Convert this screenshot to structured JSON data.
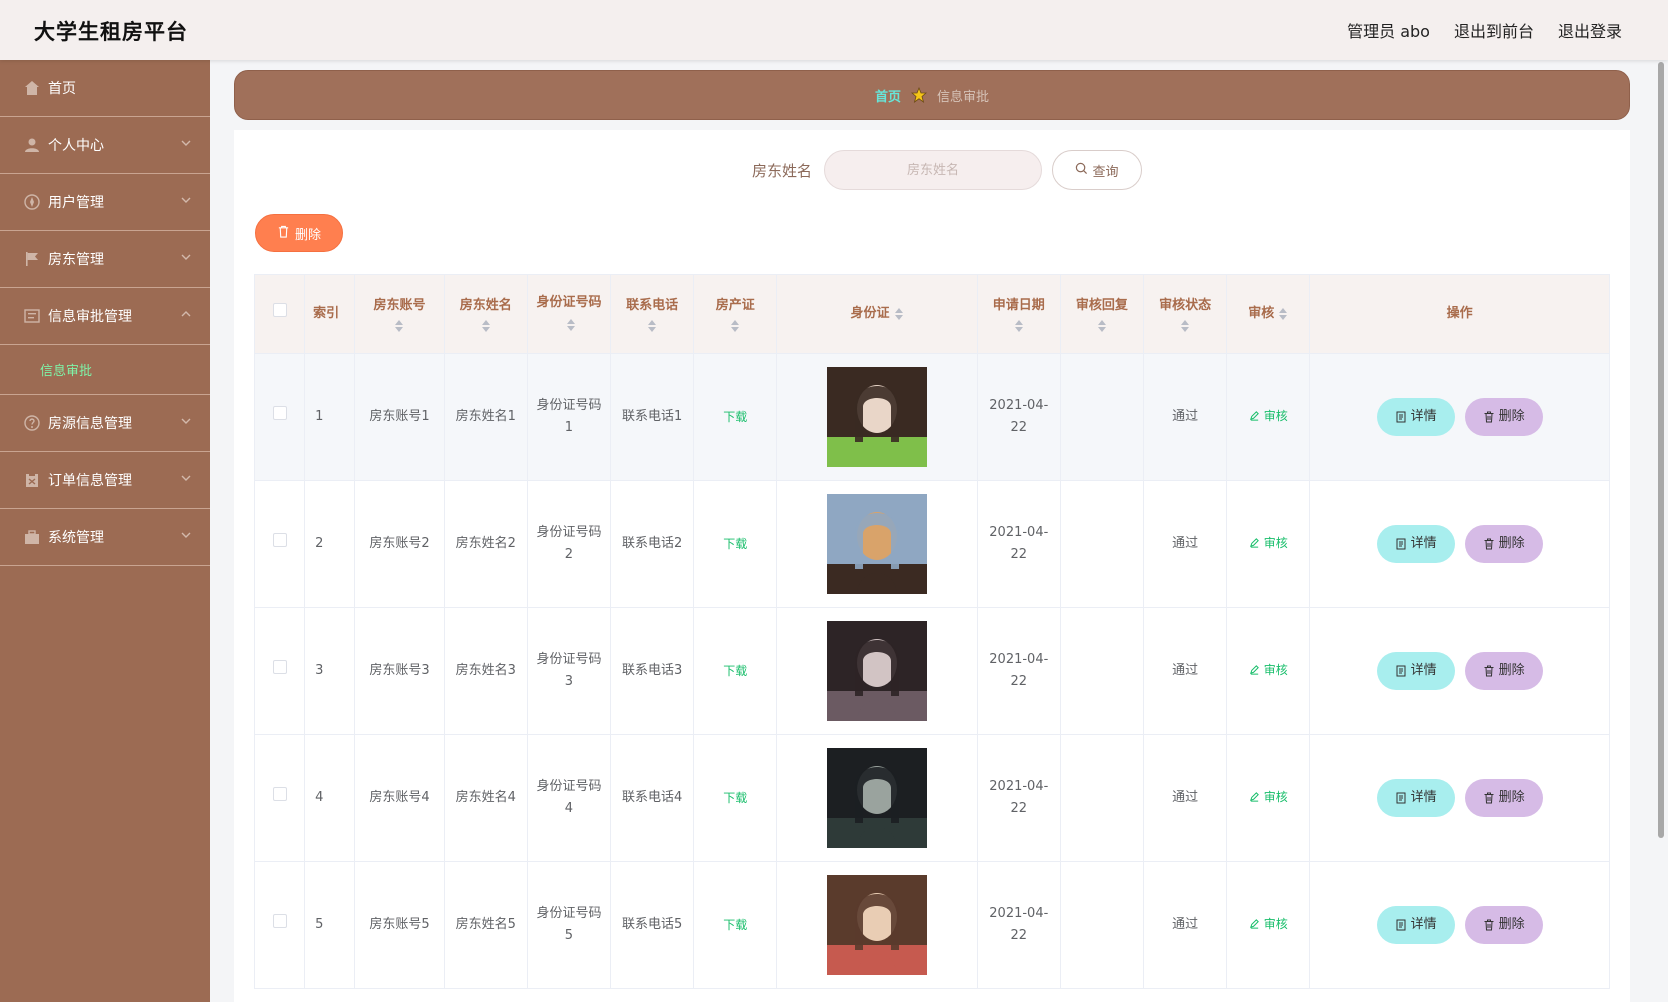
{
  "header": {
    "app_title": "大学生租房平台",
    "admin_label": "管理员 abo",
    "front_link": "退出到前台",
    "logout_link": "退出登录"
  },
  "sidebar": {
    "items": [
      {
        "label": "首页",
        "icon": "home-icon"
      },
      {
        "label": "个人中心",
        "icon": "user-icon"
      },
      {
        "label": "用户管理",
        "icon": "compass-icon"
      },
      {
        "label": "房东管理",
        "icon": "flag-icon"
      },
      {
        "label": "信息审批管理",
        "icon": "list-icon",
        "expanded": true
      },
      {
        "label": "房源信息管理",
        "icon": "help-icon"
      },
      {
        "label": "订单信息管理",
        "icon": "clipboard-icon"
      },
      {
        "label": "系统管理",
        "icon": "suitcase-icon"
      }
    ],
    "sub_item": "信息审批",
    "active_color": "#7ff4a8"
  },
  "breadcrumb": {
    "home": "首页",
    "current": "信息审批"
  },
  "search": {
    "label": "房东姓名",
    "placeholder": "房东姓名",
    "button": "查询"
  },
  "bulk_delete": "删除",
  "table": {
    "headers": {
      "index": "索引",
      "account": "房东账号",
      "name": "房东姓名",
      "idnum": "身份证号码",
      "phone": "联系电话",
      "deed": "房产证",
      "idcard": "身份证",
      "date": "申请日期",
      "reply": "审核回复",
      "status": "审核状态",
      "audit": "审核",
      "ops": "操作"
    },
    "rows": [
      {
        "index": "1",
        "account": "房东账号1",
        "name": "房东姓名1",
        "idnum": "身份证号码1",
        "phone": "联系电话1",
        "deed": "下载",
        "date": "2021-04-22",
        "reply": "",
        "status": "通过",
        "audit": "审核"
      },
      {
        "index": "2",
        "account": "房东账号2",
        "name": "房东姓名2",
        "idnum": "身份证号码2",
        "phone": "联系电话2",
        "deed": "下载",
        "date": "2021-04-22",
        "reply": "",
        "status": "通过",
        "audit": "审核"
      },
      {
        "index": "3",
        "account": "房东账号3",
        "name": "房东姓名3",
        "idnum": "身份证号码3",
        "phone": "联系电话3",
        "deed": "下载",
        "date": "2021-04-22",
        "reply": "",
        "status": "通过",
        "audit": "审核"
      },
      {
        "index": "4",
        "account": "房东账号4",
        "name": "房东姓名4",
        "idnum": "身份证号码4",
        "phone": "联系电话4",
        "deed": "下载",
        "date": "2021-04-22",
        "reply": "",
        "status": "通过",
        "audit": "审核"
      },
      {
        "index": "5",
        "account": "房东账号5",
        "name": "房东姓名5",
        "idnum": "身份证号码5",
        "phone": "联系电话5",
        "deed": "下载",
        "date": "2021-04-22",
        "reply": "",
        "status": "通过",
        "audit": "审核"
      }
    ],
    "detail_btn": "详情",
    "delete_btn": "删除"
  },
  "colors": {
    "sidebar_bg": "#9c6b53",
    "breadcrumb_bg": "#a0705a",
    "bulk_delete_bg": "#ff7f4f",
    "detail_btn_bg": "#a8eeee",
    "delete_btn_bg": "#d6bbe6",
    "link_green": "#19be6b"
  }
}
